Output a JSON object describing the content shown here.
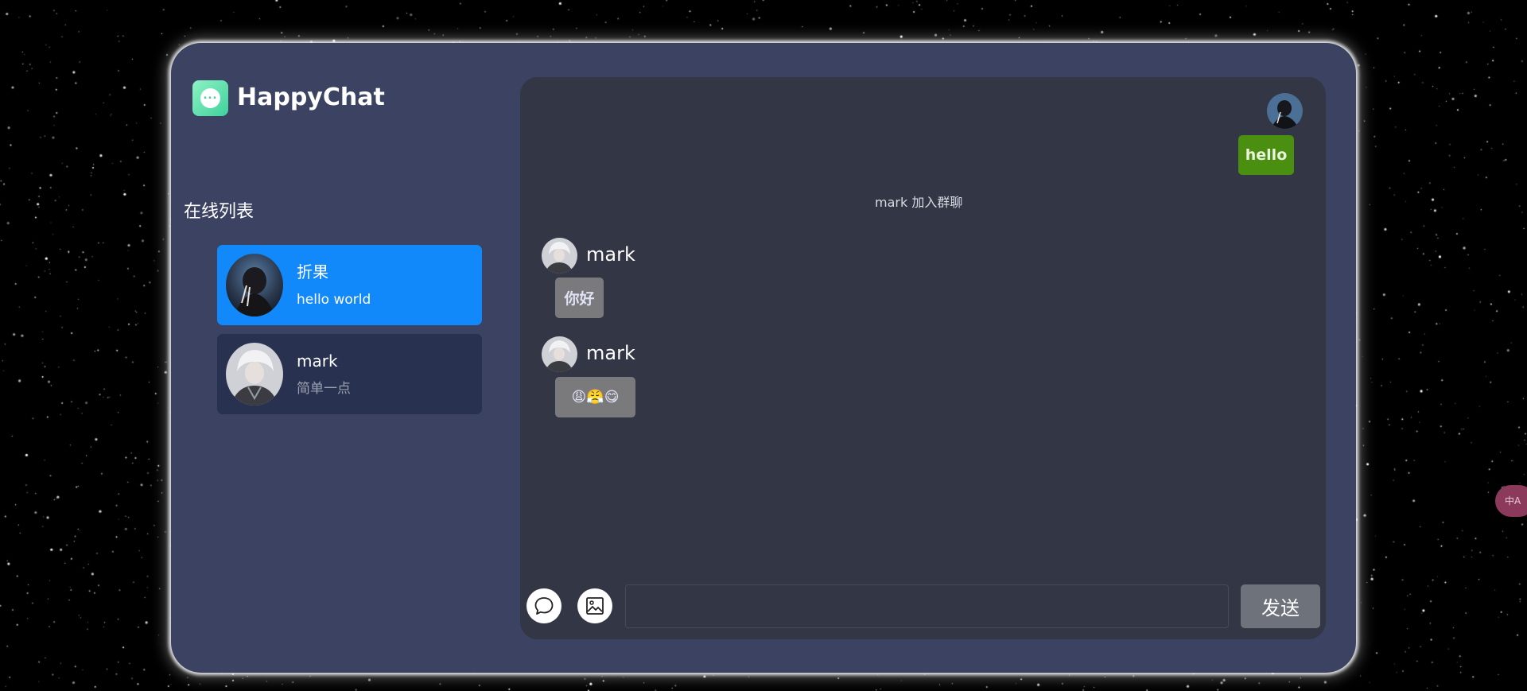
{
  "app": {
    "title": "HappyChat",
    "logo_icon": "chat-bubble-icon"
  },
  "sidebar": {
    "title": "在线列表",
    "users": [
      {
        "name": "折果",
        "message": "hello world",
        "active": true
      },
      {
        "name": "mark",
        "message": "简单一点",
        "active": false
      }
    ]
  },
  "chat": {
    "messages": [
      {
        "type": "self",
        "text": "hello"
      },
      {
        "type": "system",
        "text": "mark 加入群聊"
      },
      {
        "type": "other",
        "sender": "mark",
        "text": "你好"
      },
      {
        "type": "other",
        "sender": "mark",
        "text": "😩😤😋"
      }
    ]
  },
  "composer": {
    "input_value": "",
    "input_placeholder": "",
    "send_label": "发送",
    "emoji_icon": "speech-bubble-icon",
    "image_icon": "image-icon"
  },
  "floating": {
    "translate_label": "中A",
    "icon": "translate-icon"
  },
  "colors": {
    "app_bg": "#3b4262",
    "chat_bg": "#323645",
    "active_user": "#1289fa",
    "idle_user": "#283150",
    "self_bubble": "#4a8f0f",
    "other_bubble": "#7a7a7c",
    "send_button": "#6d727b"
  }
}
